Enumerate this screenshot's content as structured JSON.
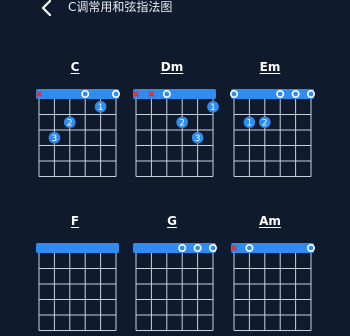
{
  "header": {
    "title": "C调常用和弦指法图",
    "back_icon": "chevron-left-icon"
  },
  "colors": {
    "background": "#0f1a2c",
    "nut": "#2f8cf0",
    "finger_dot": "#2f8cf0",
    "grid": "#c9d2de",
    "muted": "#e0302a",
    "open": "#ffffff"
  },
  "chords": [
    {
      "name": "C",
      "string_markers": [
        "x",
        "",
        "",
        "o",
        "",
        "o"
      ],
      "fingers": [
        {
          "string": 5,
          "fret": 1,
          "finger": "1"
        },
        {
          "string": 3,
          "fret": 2,
          "finger": "2"
        },
        {
          "string": 2,
          "fret": 3,
          "finger": "3"
        }
      ]
    },
    {
      "name": "Dm",
      "string_markers": [
        "x",
        "x",
        "o",
        "",
        "",
        ""
      ],
      "fingers": [
        {
          "string": 6,
          "fret": 1,
          "finger": "1"
        },
        {
          "string": 4,
          "fret": 2,
          "finger": "2"
        },
        {
          "string": 5,
          "fret": 3,
          "finger": "3"
        }
      ]
    },
    {
      "name": "Em",
      "string_markers": [
        "o",
        "",
        "",
        "o",
        "o",
        "o"
      ],
      "fingers": [
        {
          "string": 2,
          "fret": 2,
          "finger": "1"
        },
        {
          "string": 3,
          "fret": 2,
          "finger": "2"
        }
      ]
    },
    {
      "name": "F",
      "string_markers": [
        "",
        "",
        "",
        "",
        "",
        ""
      ],
      "fingers": []
    },
    {
      "name": "G",
      "string_markers": [
        "",
        "",
        "",
        "o",
        "o",
        "o"
      ],
      "fingers": []
    },
    {
      "name": "Am",
      "string_markers": [
        "x",
        "o",
        "",
        "",
        "",
        "o"
      ],
      "fingers": []
    }
  ]
}
